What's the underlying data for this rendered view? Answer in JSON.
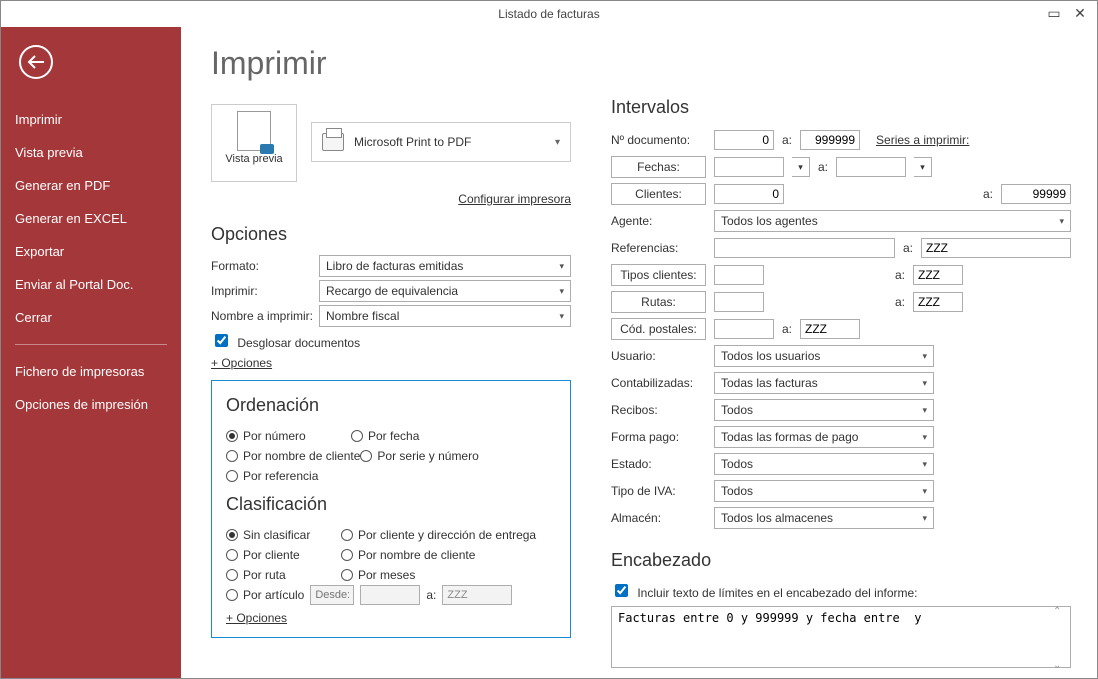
{
  "window": {
    "title": "Listado de facturas"
  },
  "sidebar": {
    "items": [
      "Imprimir",
      "Vista previa",
      "Generar en PDF",
      "Generar en EXCEL",
      "Exportar",
      "Enviar al Portal Doc.",
      "Cerrar"
    ],
    "items2": [
      "Fichero de impresoras",
      "Opciones de impresión"
    ]
  },
  "page": {
    "title": "Imprimir",
    "preview_label": "Vista previa",
    "printer": "Microsoft Print to PDF",
    "configure_link": "Configurar impresora",
    "options_heading": "Opciones",
    "formato_label": "Formato:",
    "formato_value": "Libro de facturas emitidas",
    "imprimir_label": "Imprimir:",
    "imprimir_value": "Recargo de equivalencia",
    "nombre_label": "Nombre a imprimir:",
    "nombre_value": "Nombre fiscal",
    "desglosar_label": "Desglosar documentos",
    "opciones_link": "+ Opciones"
  },
  "ordenacion": {
    "heading": "Ordenación",
    "opts": [
      "Por número",
      "Por fecha",
      "Por nombre de cliente",
      "Por serie y número",
      "Por referencia"
    ],
    "selected": 0
  },
  "clasificacion": {
    "heading": "Clasificación",
    "opts": [
      "Sin clasificar",
      "Por cliente y dirección de entrega",
      "Por cliente",
      "Por nombre de cliente",
      "Por ruta",
      "Por meses",
      "Por artículo"
    ],
    "selected": 0,
    "desde_label": "Desde:",
    "a_label": "a:",
    "a_value": "ZZZ",
    "opciones_link": "+ Opciones"
  },
  "intervalos": {
    "heading": "Intervalos",
    "ndoc_label": "Nº documento:",
    "ndoc_from": "0",
    "ndoc_to": "999999",
    "series_link": "Series a imprimir:",
    "fechas_label": "Fechas:",
    "clientes_label": "Clientes:",
    "clientes_from": "0",
    "clientes_to": "99999",
    "agente_label": "Agente:",
    "agente_value": "Todos los agentes",
    "ref_label": "Referencias:",
    "ref_to": "ZZZ",
    "tipos_label": "Tipos clientes:",
    "tipos_to": "ZZZ",
    "rutas_label": "Rutas:",
    "rutas_to": "ZZZ",
    "cp_label": "Cód. postales:",
    "cp_to": "ZZZ",
    "usuario_label": "Usuario:",
    "usuario_value": "Todos los usuarios",
    "contab_label": "Contabilizadas:",
    "contab_value": "Todas las facturas",
    "recibos_label": "Recibos:",
    "recibos_value": "Todos",
    "fp_label": "Forma pago:",
    "fp_value": "Todas las formas de pago",
    "estado_label": "Estado:",
    "estado_value": "Todos",
    "iva_label": "Tipo de IVA:",
    "iva_value": "Todos",
    "almacen_label": "Almacén:",
    "almacen_value": "Todos los almacenes",
    "a": "a:"
  },
  "encabezado": {
    "heading": "Encabezado",
    "chk_label": "Incluir texto de límites en el encabezado del informe:",
    "text": "Facturas entre 0 y 999999 y fecha entre  y"
  }
}
